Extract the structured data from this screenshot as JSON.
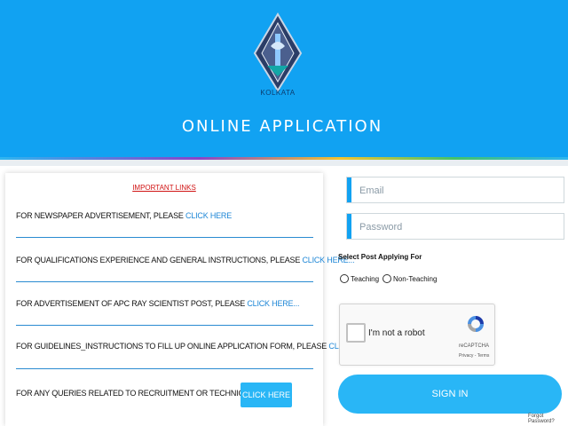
{
  "header": {
    "logo_caption": "KOLKATA",
    "title": "ONLINE APPLICATION",
    "background_color": "#11a2f2"
  },
  "notices": {
    "heading": "IMPORTANT LINKS",
    "rows": [
      {
        "text": "FOR NEWSPAPER ADVERTISEMENT, PLEASE ",
        "link": "CLICK HERE"
      },
      {
        "text": "FOR QUALIFICATIONS EXPERIENCE AND GENERAL INSTRUCTIONS, PLEASE ",
        "link": "CLICK HERE..."
      },
      {
        "text": "FOR ADVERTISEMENT OF APC RAY SCIENTIST POST, PLEASE ",
        "link": "CLICK HERE..."
      },
      {
        "text": "FOR GUIDELINES_INSTRUCTIONS TO FILL UP ONLINE APPLICATION FORM, PLEASE ",
        "link": "CLICK HERE."
      },
      {
        "text": "FOR ANY QUERIES RELATED TO RECRUITMENT OR TECHNICAL, PLEASE",
        "link": "CLICK HERE"
      }
    ]
  },
  "login": {
    "email_placeholder": "Email",
    "password_placeholder": "Password",
    "post_label": "Select Post Applying For",
    "options": [
      "Teaching",
      "Non-Teaching"
    ],
    "recaptcha_label": "I'm not a robot",
    "recaptcha_brand": "reCAPTCHA",
    "recaptcha_links": "Privacy - Terms",
    "signin_label": "SIGN IN",
    "forgot_label": "Forgot Password?",
    "accent_color": "#29b6f6"
  }
}
